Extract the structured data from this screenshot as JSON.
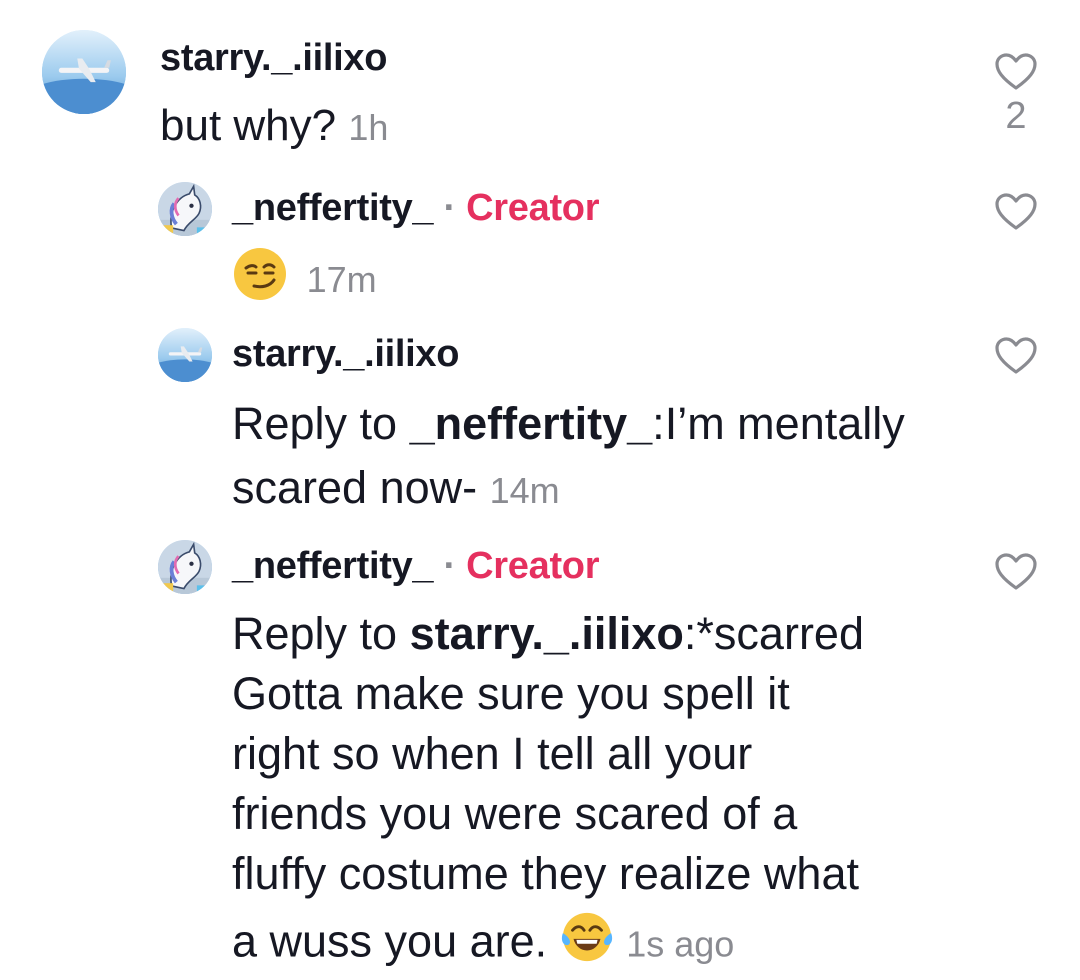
{
  "comments": [
    {
      "username": "starry._.iilixo",
      "text": "but why?",
      "time": "1h",
      "likes": "2"
    },
    {
      "username": "_neffertity_",
      "separator": "·",
      "badge": "Creator",
      "emoji": "smirking-face-emoji",
      "time": "17m"
    },
    {
      "username": "starry._.iilixo",
      "reply_prefix": "Reply to ",
      "reply_target": "_neffertity_",
      "reply_colon": ":",
      "text_line1": "I’m mentally",
      "text_line2": "scared now-",
      "time": "14m"
    },
    {
      "username": "_neffertity_",
      "separator": "·",
      "badge": "Creator",
      "reply_prefix": "Reply to ",
      "reply_target": "starry._.iilixo",
      "reply_colon": ":",
      "line1": "*scarred",
      "line2": "Gotta make sure you spell it",
      "line3": "right so when I tell all your",
      "line4": "friends you were scared of a",
      "line5": "fluffy costume they realize what",
      "line6": "a wuss you are.",
      "emoji": "tears-of-joy-emoji",
      "time": "1s ago"
    }
  ],
  "colors": {
    "creator_badge": "#e5305f",
    "secondary_text": "#8a8b91",
    "primary_text": "#161823"
  }
}
